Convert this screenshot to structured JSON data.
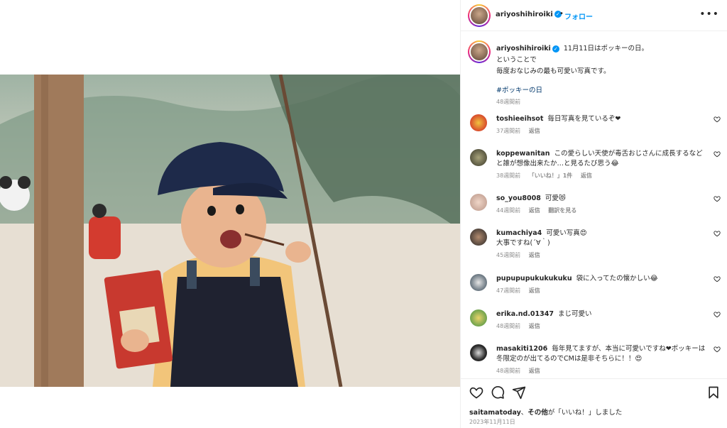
{
  "post": {
    "author": "ariyoshihiroiki",
    "follow_label": "フォロー",
    "separator": "•",
    "more_label": "•••"
  },
  "caption": {
    "author": "ariyoshihiroiki",
    "lines": [
      "11月11日はポッキーの日。",
      "ということで",
      "毎度おなじみの最も可愛い写真です。"
    ],
    "hashtag": "#ポッキーの日",
    "time": "48週間前"
  },
  "comments": [
    {
      "user": "toshieeihsot",
      "text": "毎日写真を見ているぞ❤",
      "time": "37週間前",
      "reply": "返信",
      "avatar_color": "#d84a2b"
    },
    {
      "user": "koppewanitan",
      "text": "この愛らしい天使が毒舌おじさんに成長するなどと誰が想像出来たか…と見るたび思う😂",
      "time": "38週間前",
      "likes": "「いいね！」1件",
      "reply": "返信",
      "avatar_color": "#6c6a4c"
    },
    {
      "user": "so_you8008",
      "text": "可愛😻",
      "time": "44週間前",
      "reply": "返信",
      "translate": "翻訳を見る",
      "avatar_color": "#c9a89a"
    },
    {
      "user": "kumachiya4",
      "text": "可愛い写真😍",
      "text2": "大事ですね(´∀｀)",
      "time": "45週間前",
      "reply": "返信",
      "avatar_color": "#4a3f38"
    },
    {
      "user": "pupupupukukukuku",
      "text": "袋に入ってたの懐かしい😂",
      "time": "47週間前",
      "reply": "返信",
      "avatar_color": "#6f7b85"
    },
    {
      "user": "erika.nd.01347",
      "text": "まじ可愛い",
      "time": "48週間前",
      "reply": "返信",
      "avatar_color": "#6fa34d"
    },
    {
      "user": "masakiti1206",
      "text": "毎年見てますが、本当に可愛いですね❤ポッキーは冬限定のが出てるのでCMは是非そちらに！！😍",
      "time": "48週間前",
      "reply": "返信",
      "avatar_color": "#2a2a2a"
    }
  ],
  "footer": {
    "liked_by_user": "saitamatoday",
    "liked_sep": "、",
    "liked_others": "その他",
    "liked_suffix": "が「いいね！」しました",
    "date": "2023年11月11日"
  },
  "colors": {
    "accent": "#0095f6",
    "muted": "#8e8e8e",
    "text": "#262626",
    "hashtag": "#00376b"
  }
}
